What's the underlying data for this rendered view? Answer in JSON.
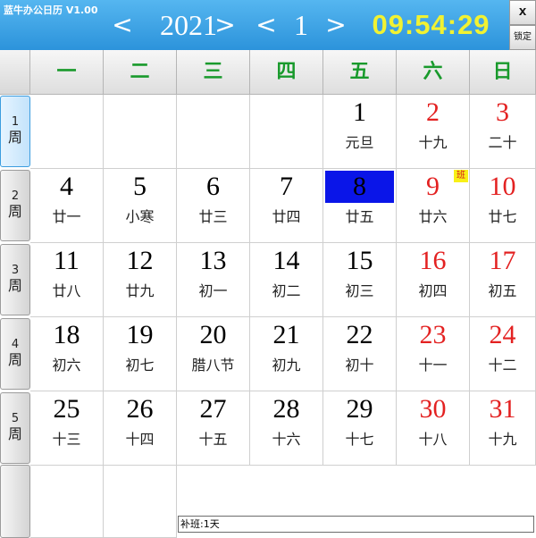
{
  "app": {
    "title": "蓝牛办公日历 V1.00"
  },
  "nav": {
    "prev_year_glyph": "<",
    "year": "2021",
    "next_year_glyph": ">",
    "prev_month_glyph": "<",
    "month": "1",
    "next_month_glyph": ">"
  },
  "clock": {
    "time": "09:54:29"
  },
  "window": {
    "close_label": "x",
    "lock_label": "锁定"
  },
  "colors": {
    "accent": "#2c93db",
    "weekday_header": "#199a2c",
    "weekend": "#e32121",
    "selected": "#0a15e8",
    "clock": "#f1f232"
  },
  "weekdays": [
    "一",
    "二",
    "三",
    "四",
    "五",
    "六",
    "日"
  ],
  "weeks": [
    {
      "number": "1",
      "suffix": "周",
      "days": [
        null,
        null,
        null,
        null,
        {
          "day": "1",
          "lunar": "元旦"
        },
        {
          "day": "2",
          "lunar": "十九",
          "weekend": true
        },
        {
          "day": "3",
          "lunar": "二十",
          "weekend": true
        }
      ]
    },
    {
      "number": "2",
      "suffix": "周",
      "days": [
        {
          "day": "4",
          "lunar": "廿一"
        },
        {
          "day": "5",
          "lunar": "小寒"
        },
        {
          "day": "6",
          "lunar": "廿三"
        },
        {
          "day": "7",
          "lunar": "廿四"
        },
        {
          "day": "8",
          "lunar": "廿五",
          "selected": true
        },
        {
          "day": "9",
          "lunar": "廿六",
          "weekend": true,
          "badge": "班"
        },
        {
          "day": "10",
          "lunar": "廿七",
          "weekend": true
        }
      ]
    },
    {
      "number": "3",
      "suffix": "周",
      "days": [
        {
          "day": "11",
          "lunar": "廿八"
        },
        {
          "day": "12",
          "lunar": "廿九"
        },
        {
          "day": "13",
          "lunar": "初一"
        },
        {
          "day": "14",
          "lunar": "初二"
        },
        {
          "day": "15",
          "lunar": "初三"
        },
        {
          "day": "16",
          "lunar": "初四",
          "weekend": true
        },
        {
          "day": "17",
          "lunar": "初五",
          "weekend": true
        }
      ]
    },
    {
      "number": "4",
      "suffix": "周",
      "days": [
        {
          "day": "18",
          "lunar": "初六"
        },
        {
          "day": "19",
          "lunar": "初七"
        },
        {
          "day": "20",
          "lunar": "腊八节"
        },
        {
          "day": "21",
          "lunar": "初九"
        },
        {
          "day": "22",
          "lunar": "初十"
        },
        {
          "day": "23",
          "lunar": "十一",
          "weekend": true
        },
        {
          "day": "24",
          "lunar": "十二",
          "weekend": true
        }
      ]
    },
    {
      "number": "5",
      "suffix": "周",
      "days": [
        {
          "day": "25",
          "lunar": "十三"
        },
        {
          "day": "26",
          "lunar": "十四"
        },
        {
          "day": "27",
          "lunar": "十五"
        },
        {
          "day": "28",
          "lunar": "十六"
        },
        {
          "day": "29",
          "lunar": "十七"
        },
        {
          "day": "30",
          "lunar": "十八",
          "weekend": true
        },
        {
          "day": "31",
          "lunar": "十九",
          "weekend": true
        }
      ]
    }
  ],
  "note": "补班:1天"
}
